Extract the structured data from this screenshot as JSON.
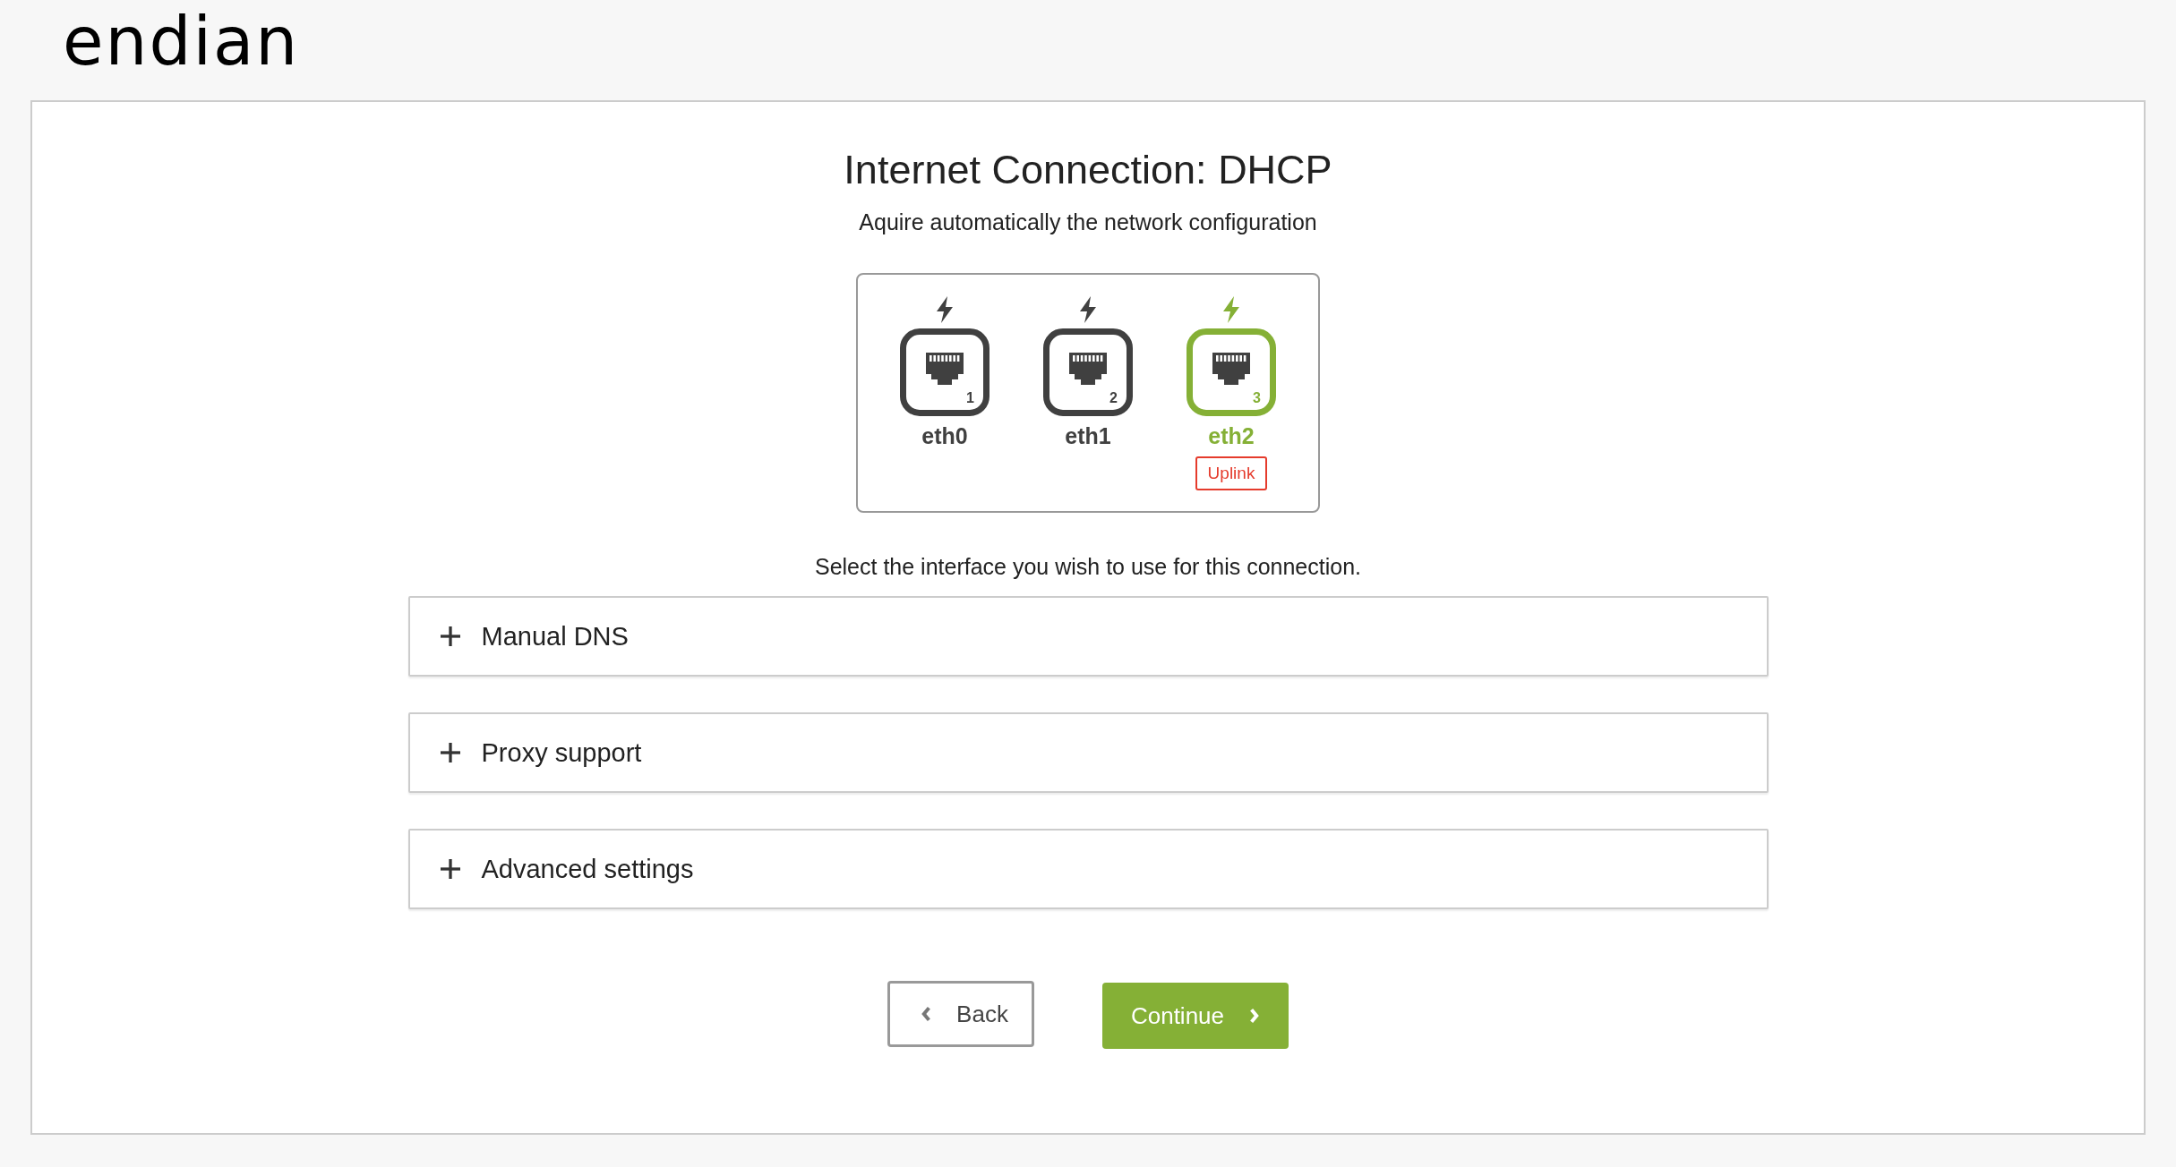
{
  "logo": "endian",
  "heading": {
    "title": "Internet Connection: DHCP",
    "subtitle": "Aquire automatically the network configuration"
  },
  "interfaces": [
    {
      "name": "eth0",
      "number": "1",
      "selected": false
    },
    {
      "name": "eth1",
      "number": "2",
      "selected": false
    },
    {
      "name": "eth2",
      "number": "3",
      "selected": true,
      "badge": "Uplink"
    }
  ],
  "hint": "Select the interface you wish to use for this connection.",
  "sections": [
    {
      "label": "Manual DNS",
      "expanded": false
    },
    {
      "label": "Proxy support",
      "expanded": false
    },
    {
      "label": "Advanced settings",
      "expanded": false
    }
  ],
  "buttons": {
    "back": "Back",
    "continue": "Continue"
  }
}
